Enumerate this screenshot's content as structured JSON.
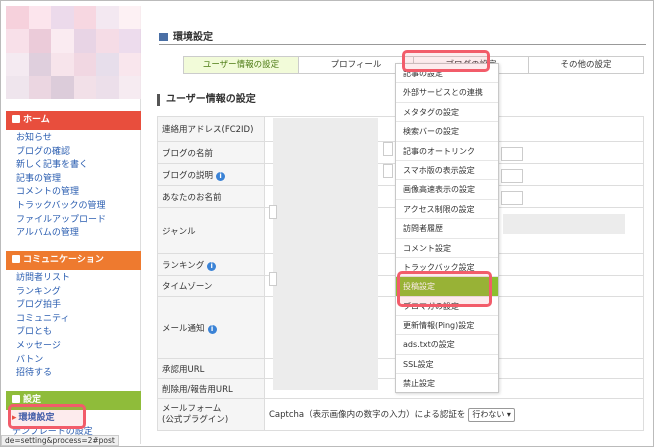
{
  "sidebar": {
    "home": {
      "label": "ホーム",
      "color": "#e84e3d"
    },
    "home_items": [
      "お知らせ",
      "ブログの確認",
      "新しく記事を書く",
      "記事の管理",
      "コメントの管理",
      "トラックバックの管理",
      "ファイルアップロード",
      "アルバムの管理"
    ],
    "community": {
      "label": "コミュニケーション",
      "color": "#ee7a2f"
    },
    "community_items": [
      "訪問者リスト",
      "ランキング",
      "ブログ拍手",
      "コミュニティ",
      "ブロとも",
      "メッセージ",
      "バトン",
      "招待する"
    ],
    "settings": {
      "label": "設定",
      "color": "#8fbc3a"
    },
    "settings_items": [
      "環境設定",
      "テンプレートの設定"
    ]
  },
  "main": {
    "page_title": "環境設定",
    "tabs": [
      "ユーザー情報の設定",
      "プロフィール",
      "ブログの設定",
      "その他の設定"
    ],
    "section_title": "ユーザー情報の設定",
    "rows": [
      {
        "label": "連絡用アドレス(FC2ID)"
      },
      {
        "label": "ブログの名前"
      },
      {
        "label": "ブログの説明",
        "info": "i"
      },
      {
        "label": "あなたのお名前"
      },
      {
        "label": "ジャンル"
      },
      {
        "label": "ランキング",
        "info": "i"
      },
      {
        "label": "タイムゾーン"
      },
      {
        "label": "メール通知",
        "info": "i"
      },
      {
        "label": "承認用URL"
      },
      {
        "label": "削除用/報告用URL"
      },
      {
        "label": "メールフォーム\n(公式プラグイン)",
        "value": "Captcha（表示画像内の数字の入力）による認証を",
        "select": "行わない ▾"
      }
    ]
  },
  "dropdown": {
    "items": [
      "記事の設定",
      "外部サービスとの連携",
      "メタタグの設定",
      "検索バーの設定",
      "記事のオートリンク",
      "スマホ版の表示設定",
      "画像高速表示の設定",
      "アクセス制限の設定",
      "訪問者履歴",
      "コメント設定",
      "トラックバック設定",
      "投稿設定",
      "ブロマガの設定",
      "更新情報(Ping)設定",
      "ads.txtの設定",
      "SSL設定",
      "禁止設定"
    ],
    "active_index": 11
  },
  "status_bar": {
    "text": "de=setting&process=2#post"
  },
  "colors": {
    "highlight": "#f25c6a",
    "active_item": "#8cbf2f",
    "link": "#2a5db0"
  }
}
